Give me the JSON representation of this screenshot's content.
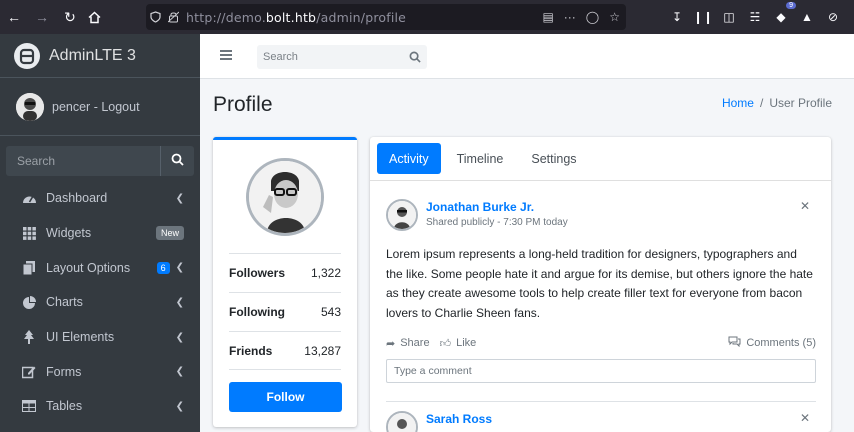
{
  "browser": {
    "url_prefix": "http://demo.",
    "url_domain": "bolt.htb",
    "url_path": "/admin/profile",
    "ext_badge": "9"
  },
  "sidebar": {
    "brand": "AdminLTE 3",
    "user_label": "pencer - Logout",
    "search_placeholder": "Search",
    "items": [
      {
        "label": "Dashboard",
        "icon": "tachometer-icon",
        "caret": true
      },
      {
        "label": "Widgets",
        "icon": "th-icon",
        "badge": "New"
      },
      {
        "label": "Layout Options",
        "icon": "copy-icon",
        "badge": "6",
        "caret": true
      },
      {
        "label": "Charts",
        "icon": "pie-chart-icon",
        "caret": true
      },
      {
        "label": "UI Elements",
        "icon": "tree-icon",
        "caret": true
      },
      {
        "label": "Forms",
        "icon": "edit-icon",
        "caret": true
      },
      {
        "label": "Tables",
        "icon": "table-icon",
        "caret": true
      }
    ]
  },
  "topnav": {
    "search_placeholder": "Search"
  },
  "header": {
    "title": "Profile",
    "breadcrumb_home": "Home",
    "breadcrumb_sep": "/",
    "breadcrumb_current": "User Profile"
  },
  "profile": {
    "stats": [
      {
        "label": "Followers",
        "value": "1,322"
      },
      {
        "label": "Following",
        "value": "543"
      },
      {
        "label": "Friends",
        "value": "13,287"
      }
    ],
    "follow_label": "Follow"
  },
  "activity": {
    "tabs": [
      "Activity",
      "Timeline",
      "Settings"
    ],
    "post1": {
      "name": "Jonathan Burke Jr.",
      "desc": "Shared publicly - 7:30 PM today",
      "body": "Lorem ipsum represents a long-held tradition for designers, typographers and the like. Some people hate it and argue for its demise, but others ignore the hate as they create awesome tools to help create filler text for everyone from bacon lovers to Charlie Sheen fans.",
      "share": "Share",
      "like": "Like",
      "comments": "Comments (5)",
      "comment_placeholder": "Type a comment"
    },
    "post2": {
      "name": "Sarah Ross"
    }
  },
  "colors": {
    "primary": "#007bff",
    "sidebar_bg": "#343a40"
  }
}
